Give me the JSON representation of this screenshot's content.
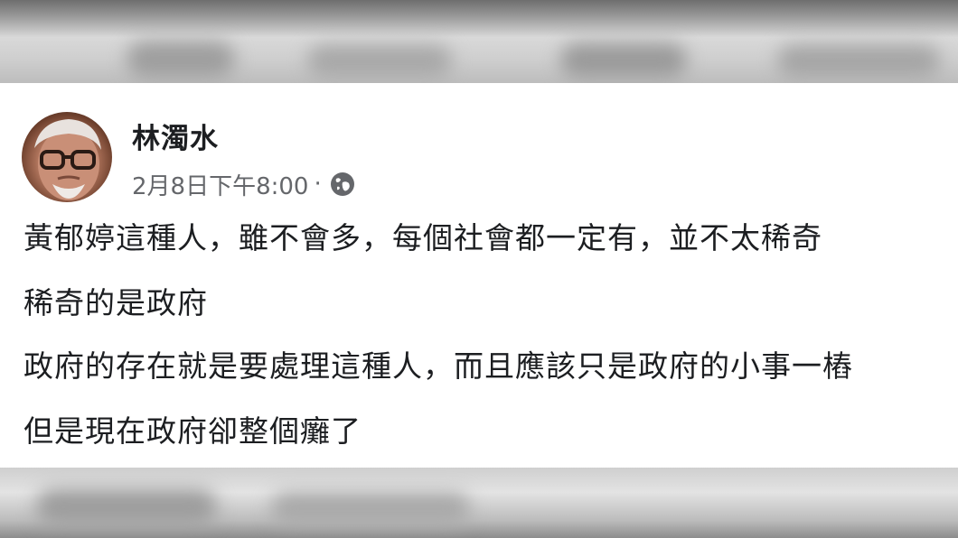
{
  "post": {
    "author": "林濁水",
    "timestamp": "2月8日下午8:00",
    "separator": "·",
    "audience_icon": "globe-icon",
    "lines": [
      "黃郁婷這種人，雖不會多，每個社會都一定有，並不太稀奇",
      "稀奇的是政府",
      "政府的存在就是要處理這種人，而且應該只是政府的小事一樁",
      "但是現在政府卻整個癱了"
    ]
  },
  "colors": {
    "name": "#1c1e21",
    "meta": "#65676b",
    "card_bg": "#ffffff"
  }
}
